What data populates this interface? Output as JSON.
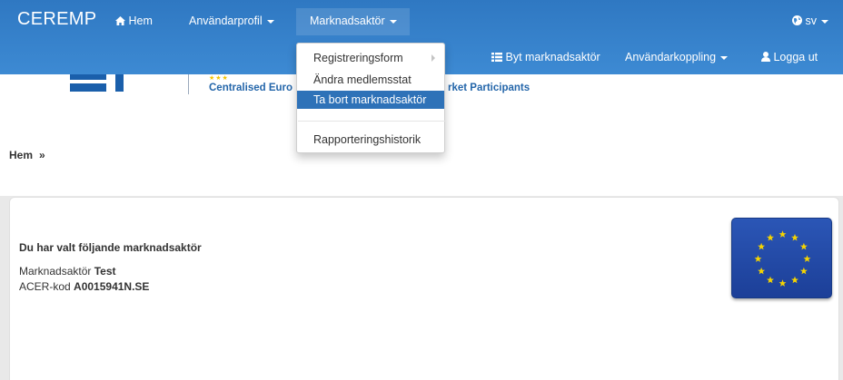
{
  "navbar": {
    "brand": "CEREMP",
    "home": "Hem",
    "user_profile": "Användarprofil",
    "market_participant": "Marknadsaktör",
    "language": "sv",
    "switch_participant": "Byt marknadsaktör",
    "user_link": "Användarkoppling",
    "logout": "Logga ut"
  },
  "banner": {
    "text_left": "Centralised Euro",
    "text_right": "rket Participants"
  },
  "breadcrumb": {
    "home": "Hem",
    "separator": "»"
  },
  "dropdown": {
    "items": [
      {
        "label": "Registreringsform",
        "submenu": true,
        "active": false
      },
      {
        "label": "Ändra medlemsstat",
        "submenu": false,
        "active": false
      },
      {
        "label": "Ta bort marknadsaktör",
        "submenu": false,
        "active": true
      },
      {
        "label": "Rapporteringshistorik",
        "submenu": false,
        "active": false
      }
    ]
  },
  "panel": {
    "heading": "Du har valt följande marknadsaktör",
    "participant_label": "Marknadsaktör",
    "participant_value": "Test",
    "acer_label": "ACER-kod",
    "acer_value": "A0015941N.SE"
  },
  "colors": {
    "navbar": "#3d8ad3",
    "active_menu_item": "#2e72b8",
    "flag_blue": "#2b56b6",
    "flag_star": "#f5d400"
  },
  "icons": [
    "home-icon",
    "globe-icon",
    "list-icon",
    "user-icon",
    "caret-down-icon",
    "caret-right-icon",
    "eu-flag"
  ]
}
